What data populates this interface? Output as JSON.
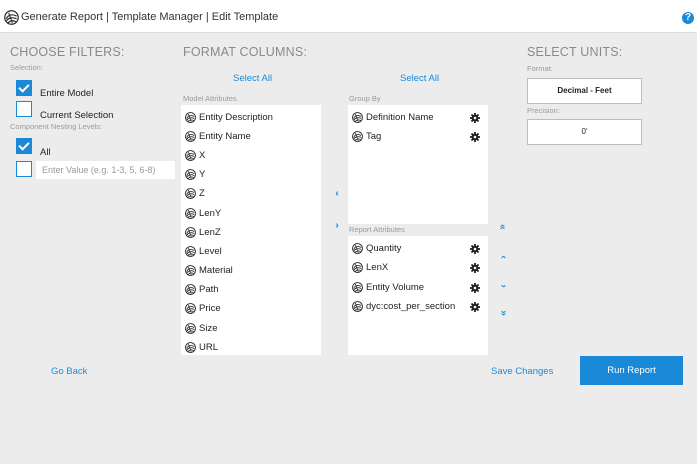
{
  "header": {
    "title": "Generate Report | Template Manager | Edit Template",
    "logo_icon": "sketchup-logo-icon",
    "help_glyph": "?"
  },
  "filters": {
    "title": "CHOOSE FILTERS:",
    "selection_label": "Selection:",
    "options": [
      {
        "label": "Entire Model",
        "checked": true
      },
      {
        "label": "Current Selection",
        "checked": false
      }
    ],
    "nesting_label": "Component Nesting Levels:",
    "nesting_all": {
      "label": "All",
      "checked": true
    },
    "nesting_custom": {
      "checked": false,
      "placeholder": "Enter Value (e.g. 1-3, 5, 6-8)"
    }
  },
  "columns": {
    "title": "FORMAT COLUMNS:",
    "select_all_label": "Select All",
    "model_attributes_label": "Model Attributes",
    "model_attributes": [
      "Entity Description",
      "Entity Name",
      "X",
      "Y",
      "Z",
      "LenY",
      "LenZ",
      "Level",
      "Material",
      "Path",
      "Price",
      "Size",
      "URL"
    ],
    "group_by_label": "Group By",
    "group_by": [
      "Definition Name",
      "Tag"
    ],
    "report_attributes_label": "Report Attributes",
    "report_attributes": [
      "Quantity",
      "LenX",
      "Entity Volume",
      "dyc:cost_per_section"
    ],
    "move_left_glyph": "‹",
    "move_right_glyph": "›",
    "move_top_glyph": "»",
    "move_up_glyph": "‹",
    "move_down_glyph": "›",
    "move_bottom_glyph": "»"
  },
  "units": {
    "title": "SELECT UNITS:",
    "format_label": "Format:",
    "format_value": "Decimal - Feet",
    "precision_label": "Precision:",
    "precision_value": "0'"
  },
  "footer": {
    "go_back_label": "Go Back",
    "save_label": "Save Changes",
    "run_label": "Run Report"
  },
  "colors": {
    "accent": "#1a8ad8",
    "background": "#ececec",
    "panel": "#ffffff"
  }
}
